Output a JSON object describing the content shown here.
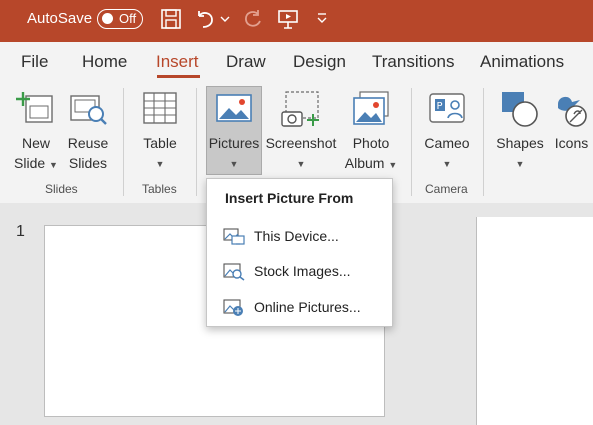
{
  "titlebar": {
    "autosave_label": "AutoSave",
    "autosave_state": "Off",
    "accent_color": "#b7472a"
  },
  "tabs": [
    "File",
    "Home",
    "Insert",
    "Draw",
    "Design",
    "Transitions",
    "Animations"
  ],
  "active_tab": "Insert",
  "ribbon": {
    "new_slide": {
      "line1": "New",
      "line2": "Slide"
    },
    "reuse_slides": {
      "line1": "Reuse",
      "line2": "Slides"
    },
    "table": "Table",
    "pictures": "Pictures",
    "screenshot": "Screenshot",
    "photo_album": {
      "line1": "Photo",
      "line2": "Album"
    },
    "cameo": "Cameo",
    "shapes": "Shapes",
    "icons": "Icons",
    "groups": {
      "slides": "Slides",
      "tables": "Tables",
      "camera": "Camera"
    }
  },
  "dropdown": {
    "header": "Insert Picture From",
    "items": [
      "This Device...",
      "Stock Images...",
      "Online Pictures..."
    ]
  },
  "slides": {
    "number": "1"
  }
}
